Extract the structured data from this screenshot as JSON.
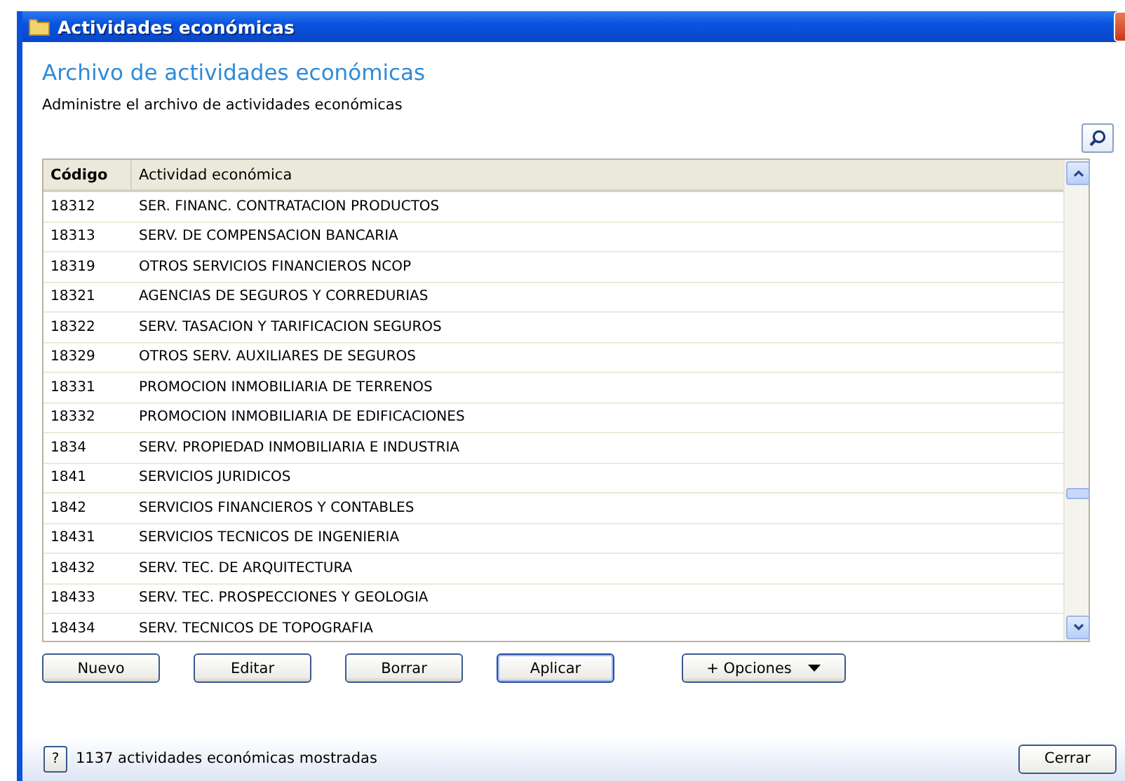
{
  "window": {
    "title": "Actividades económicas"
  },
  "heading": "Archivo de actividades económicas",
  "subtitle": "Administre el archivo de actividades económicas",
  "table": {
    "columns": [
      "Código",
      "Actividad económica"
    ],
    "rows": [
      [
        "18312",
        "SER. FINANC. CONTRATACION PRODUCTOS"
      ],
      [
        "18313",
        "SERV. DE COMPENSACION BANCARIA"
      ],
      [
        "18319",
        "OTROS SERVICIOS FINANCIEROS NCOP"
      ],
      [
        "18321",
        "AGENCIAS DE SEGUROS Y CORREDURIAS"
      ],
      [
        "18322",
        "SERV. TASACION Y TARIFICACION SEGUROS"
      ],
      [
        "18329",
        "OTROS SERV. AUXILIARES DE SEGUROS"
      ],
      [
        "18331",
        "PROMOCION INMOBILIARIA DE TERRENOS"
      ],
      [
        "18332",
        "PROMOCION INMOBILIARIA DE EDIFICACIONES"
      ],
      [
        "1834",
        "SERV. PROPIEDAD INMOBILIARIA E INDUSTRIA"
      ],
      [
        "1841",
        "SERVICIOS JURIDICOS"
      ],
      [
        "1842",
        "SERVICIOS FINANCIEROS Y CONTABLES"
      ],
      [
        "18431",
        "SERVICIOS TECNICOS DE INGENIERIA"
      ],
      [
        "18432",
        "SERV. TEC. DE ARQUITECTURA"
      ],
      [
        "18433",
        "SERV. TEC. PROSPECCIONES Y GEOLOGIA"
      ],
      [
        "18434",
        "SERV. TECNICOS DE TOPOGRAFIA"
      ]
    ]
  },
  "buttons": [
    {
      "label": "Nuevo",
      "kind": "plain"
    },
    {
      "label": "Editar",
      "kind": "plain"
    },
    {
      "label": "Borrar",
      "kind": "plain"
    },
    {
      "label": "Aplicar",
      "kind": "default"
    },
    {
      "label": "+ Opciones",
      "kind": "menu"
    }
  ],
  "status_bar": {
    "help": "?",
    "text": "1137 actividades económicas mostradas",
    "close": "Cerrar"
  }
}
